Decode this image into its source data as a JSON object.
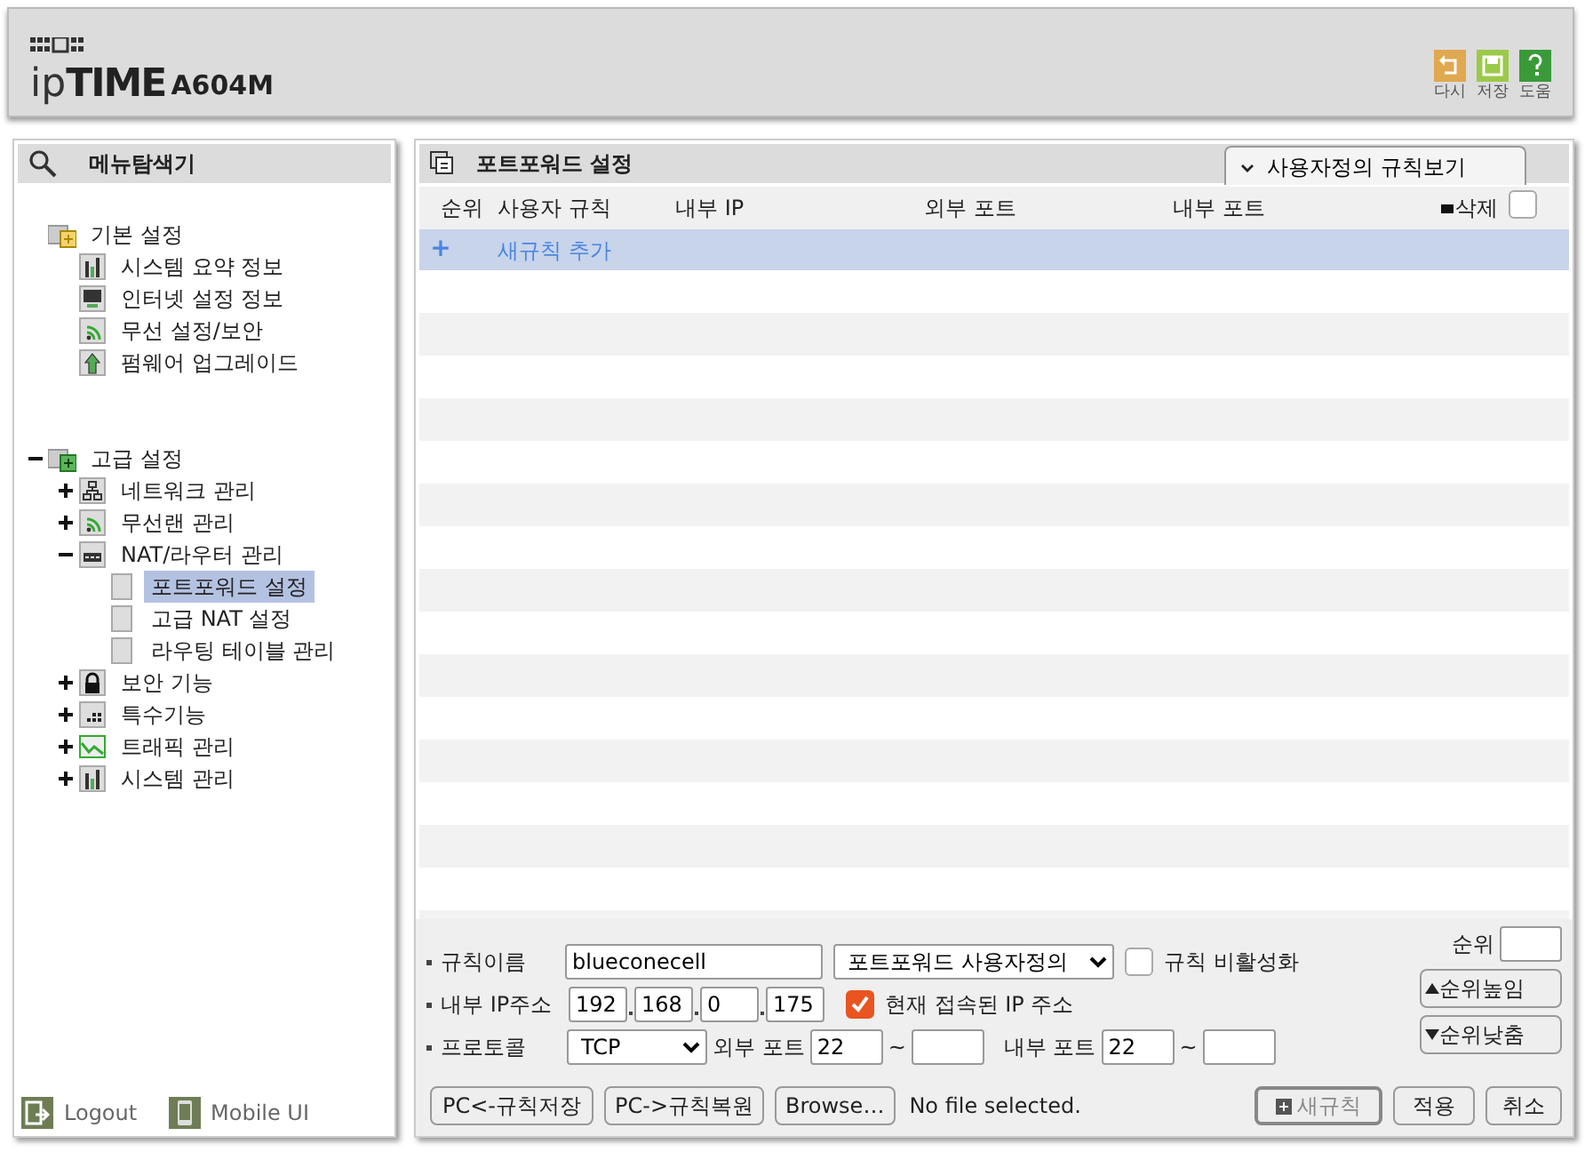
{
  "header": {
    "brand": "ip**TIME**",
    "model": "A604M",
    "tools": [
      {
        "kind": "undo",
        "label": "다시"
      },
      {
        "kind": "save",
        "label": "저장"
      },
      {
        "kind": "help",
        "label": "도움"
      }
    ]
  },
  "sidebar": {
    "title": "메뉴탐색기",
    "tree": [
      {
        "label": "기본 설정",
        "kind": "folder",
        "children": [
          {
            "label": "시스템 요약 정보",
            "kind": "chart",
            "selected": false
          },
          {
            "label": "인터넷 설정 정보",
            "kind": "monitor",
            "selected": false
          },
          {
            "label": "무선 설정/보안",
            "kind": "wireless",
            "selected": false
          },
          {
            "label": "펌웨어 업그레이드",
            "kind": "upgrade",
            "selected": false
          }
        ]
      },
      {
        "label": "고급 설정",
        "kind": "folderplus",
        "expanded": true,
        "children": [
          {
            "label": "네트워크 관리",
            "kind": "network",
            "expanded": false
          },
          {
            "label": "무선랜 관리",
            "kind": "wireless",
            "expanded": false
          },
          {
            "label": "NAT/라우터 관리",
            "kind": "router",
            "expanded": true,
            "children": [
              {
                "label": "포트포워드 설정",
                "kind": "page",
                "selected": true
              },
              {
                "label": "고급 NAT 설정",
                "kind": "page",
                "selected": false
              },
              {
                "label": "라우팅 테이블 관리",
                "kind": "page",
                "selected": false
              }
            ]
          },
          {
            "label": "보안 기능",
            "kind": "lock",
            "expanded": false
          },
          {
            "label": "특수기능",
            "kind": "special",
            "expanded": false
          },
          {
            "label": "트래픽 관리",
            "kind": "traffic",
            "expanded": false
          },
          {
            "label": "시스템 관리",
            "kind": "chart",
            "expanded": false
          }
        ]
      }
    ],
    "footer": [
      {
        "kind": "logout",
        "label": "Logout"
      },
      {
        "kind": "mobile",
        "label": "Mobile UI"
      }
    ]
  },
  "main": {
    "title": "포트포워드 설정",
    "view_button": "사용자정의 규칙보기",
    "columns": [
      "순위",
      "사용자 규칙",
      "내부 IP",
      "외부 포트",
      "내부 포트",
      "삭제"
    ],
    "delete_all_checked": false,
    "add_row": {
      "symbol": "+",
      "label": "새규칙 추가"
    },
    "form": {
      "rule_name": {
        "label": "규칙이름",
        "value": "blueconecell",
        "preset": "포트포워드 사용자정의",
        "disable_label": "규칙 비활성화",
        "disabled_checked": false
      },
      "ip": {
        "label": "내부 IP주소",
        "octets": [
          "192",
          "168",
          "0",
          "175"
        ],
        "current_label": "현재 접속된 IP 주소",
        "current_checked": true
      },
      "protocol": {
        "label": "프로토콜",
        "value": "TCP",
        "ext_label": "외부 포트",
        "ext_from": "22",
        "ext_sep": "~",
        "int_label": "내부 포트",
        "int_from": "22",
        "int_sep": "~"
      },
      "order": {
        "label": "순위",
        "up": "순위높임",
        "down": "순위낮춤"
      }
    },
    "buttons": [
      {
        "kind": "plain",
        "label": "PC<-규칙저장"
      },
      {
        "kind": "plain",
        "label": "PC->규칙복원"
      },
      {
        "kind": "file",
        "label": "Browse…",
        "status": "No file selected."
      },
      {
        "kind": "new",
        "label": "새규칙",
        "disabled": true
      },
      {
        "kind": "plain",
        "label": "적용"
      },
      {
        "kind": "plain",
        "label": "취소"
      }
    ]
  }
}
